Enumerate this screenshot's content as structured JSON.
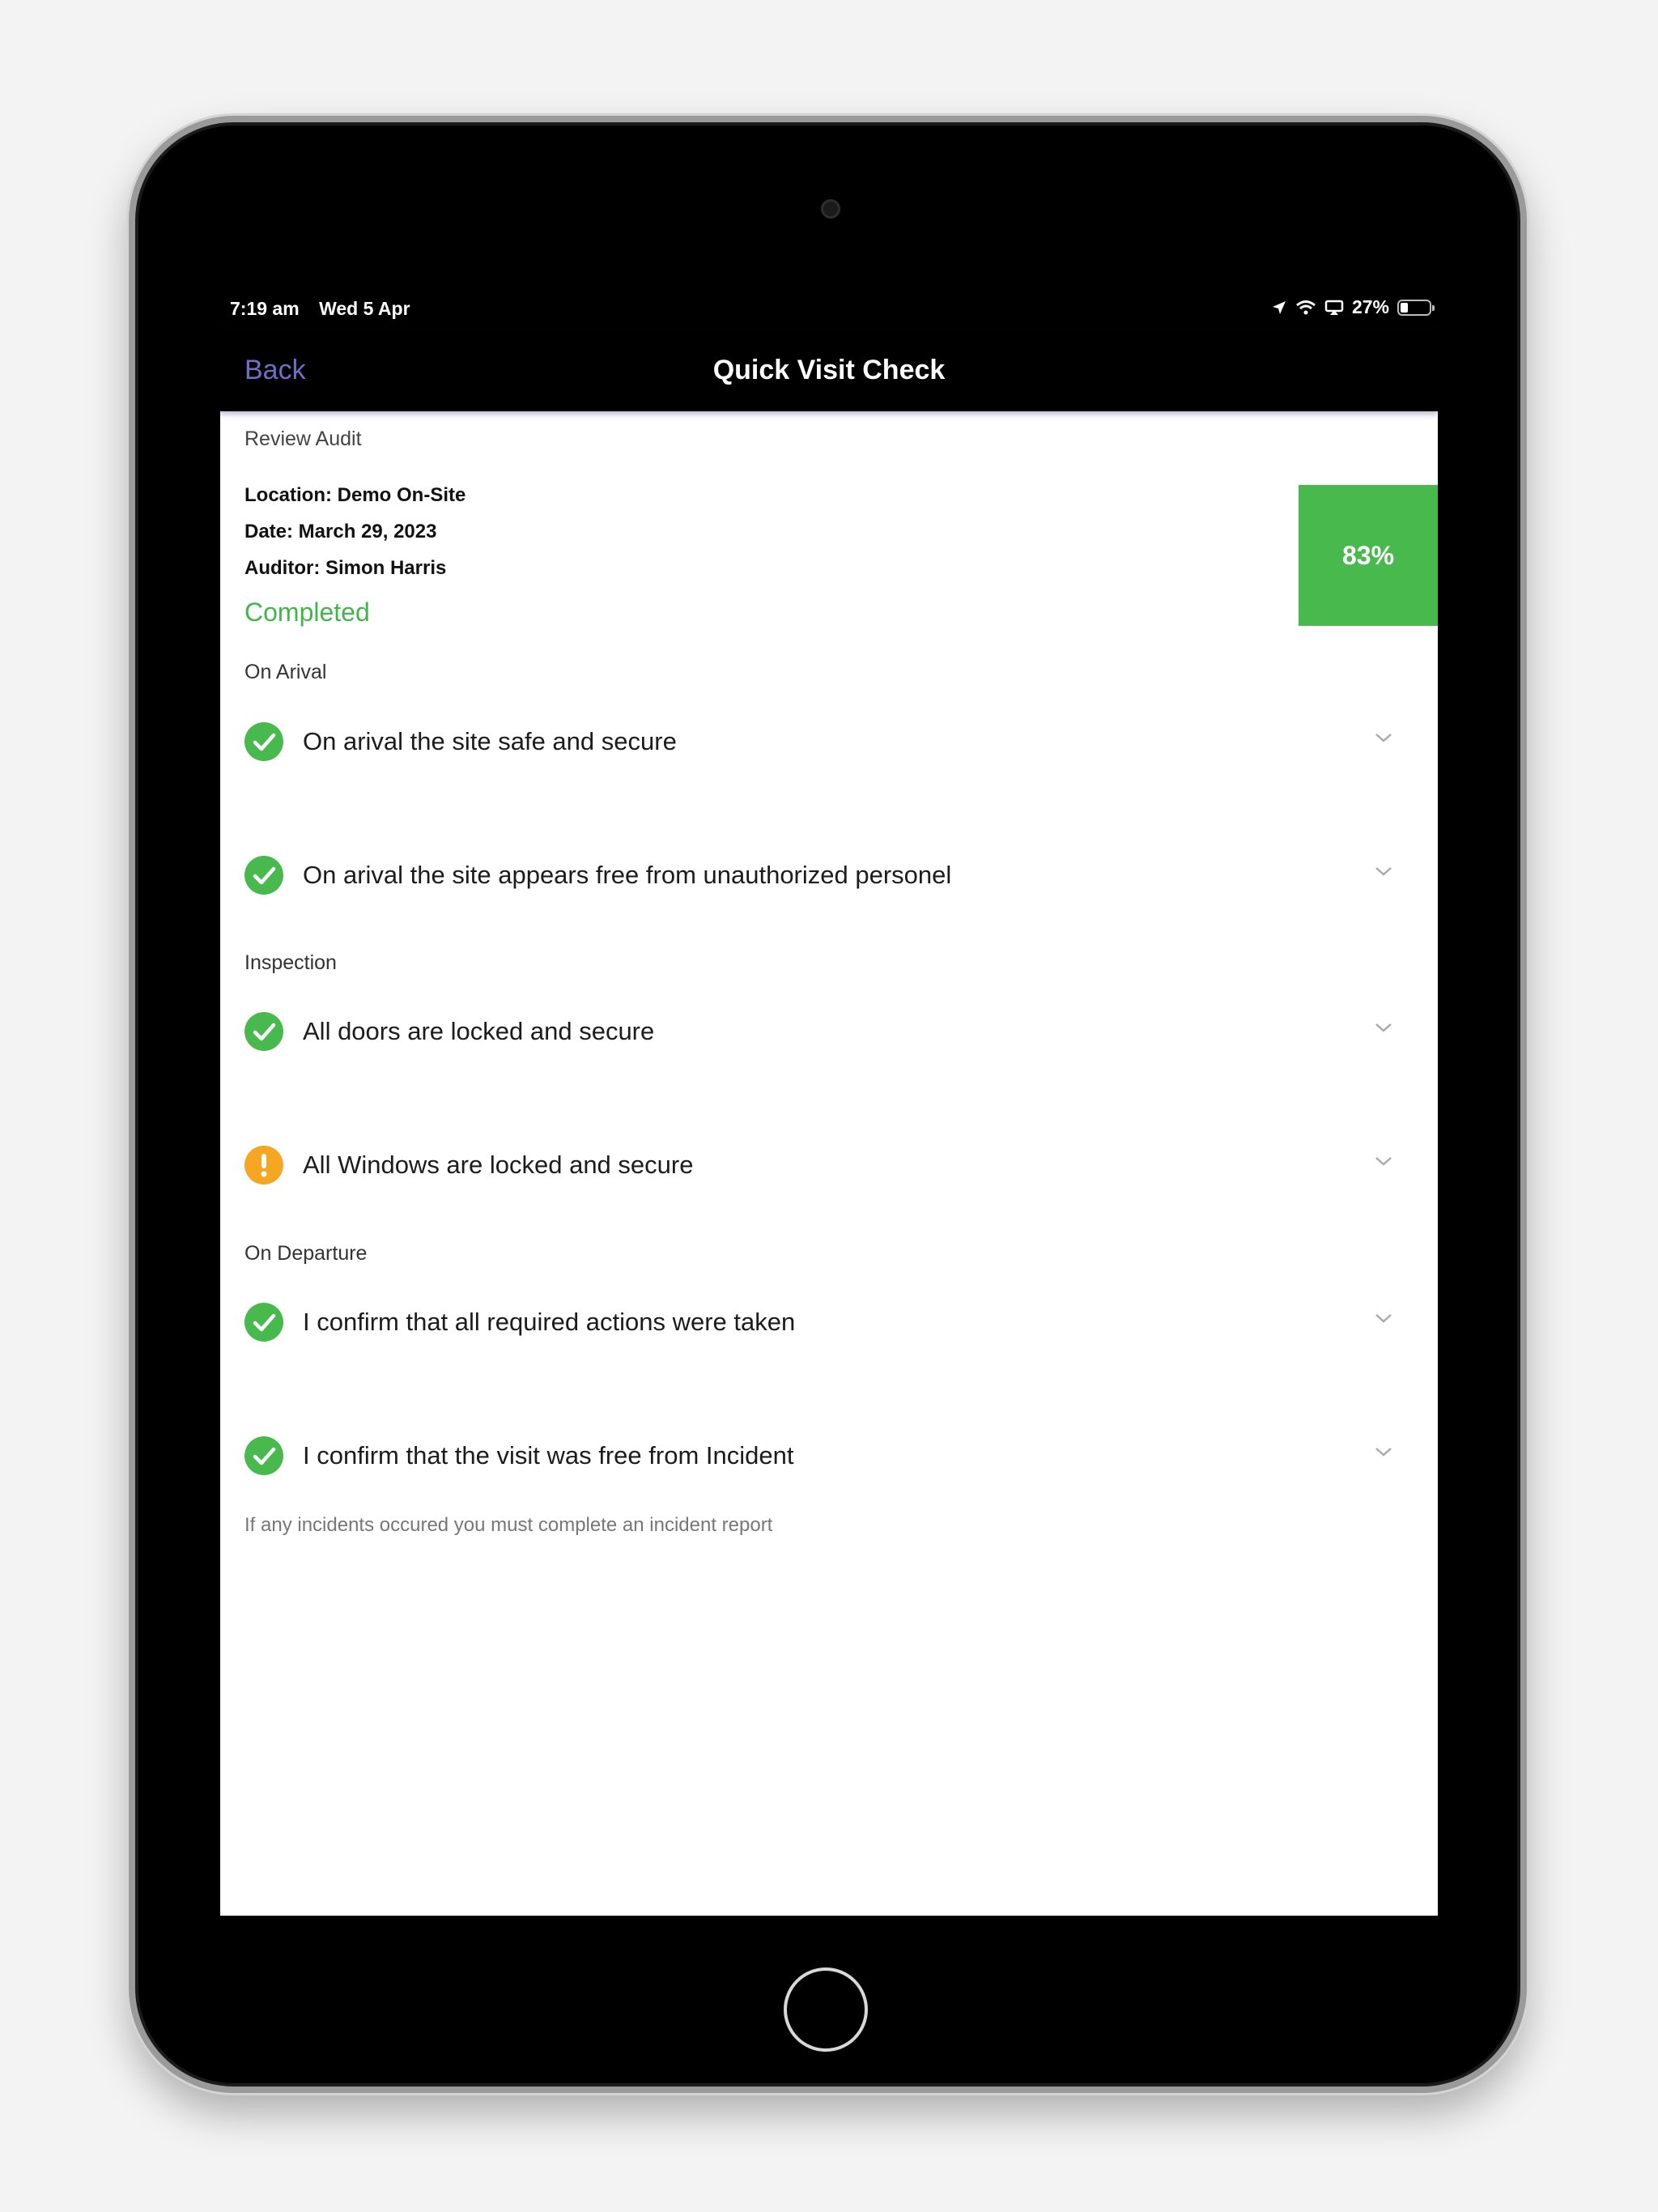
{
  "status_bar": {
    "time": "7:19 am",
    "date": "Wed 5 Apr",
    "battery_percent": "27%",
    "battery_level": 0.27
  },
  "nav": {
    "back_label": "Back",
    "title": "Quick Visit Check"
  },
  "audit": {
    "header": "Review Audit",
    "location": "Location: Demo On-Site",
    "date": "Date: March 29, 2023",
    "auditor": "Auditor: Simon Harris",
    "status": "Completed",
    "score": "83%"
  },
  "sections": [
    {
      "label": "On Arival",
      "items": [
        {
          "text": "On arival the site safe and secure",
          "state": "check"
        },
        {
          "text": "On arival the site appears free from unauthorized personel",
          "state": "check"
        }
      ]
    },
    {
      "label": "Inspection",
      "items": [
        {
          "text": "All doors are locked and secure",
          "state": "check"
        },
        {
          "text": "All Windows are locked and secure",
          "state": "warning"
        }
      ]
    },
    {
      "label": "On Departure",
      "items": [
        {
          "text": "I confirm that all required actions were taken",
          "state": "check"
        },
        {
          "text": "I confirm that the visit was free from Incident",
          "state": "check"
        }
      ]
    }
  ],
  "footnote": "If any incidents occured you must complete an incident report",
  "colors": {
    "success": "#48b94d",
    "warning": "#f5a623",
    "link": "#6f6fc5"
  }
}
